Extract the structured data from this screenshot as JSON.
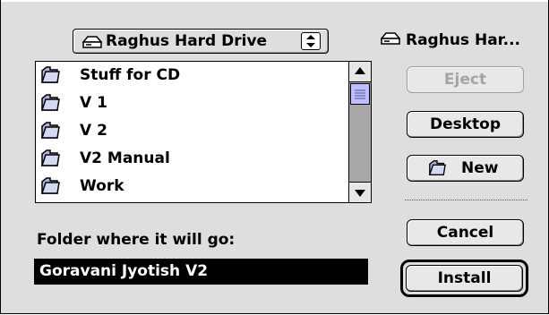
{
  "volume_popup": {
    "label": "Raghus Hard Drive",
    "icon": "hard-drive-icon",
    "arrows_icon": "updown-arrows-icon"
  },
  "volume_name": "Raghus Har...",
  "file_list": {
    "items": [
      {
        "name": "Stuff for CD",
        "icon": "folder-icon"
      },
      {
        "name": "V 1",
        "icon": "folder-icon"
      },
      {
        "name": "V 2",
        "icon": "folder-icon"
      },
      {
        "name": "V2 Manual",
        "icon": "folder-icon"
      },
      {
        "name": "Work",
        "icon": "folder-icon"
      }
    ]
  },
  "buttons": {
    "eject": "Eject",
    "desktop": "Desktop",
    "new": "New",
    "cancel": "Cancel",
    "install": "Install"
  },
  "folder_label": "Folder where it will go:",
  "folder_field_value": "Goravani Jyotish V2",
  "colors": {
    "dialog_bg": "#dedede",
    "scroll_thumb": "#bfbfff",
    "selection_bg": "#000000"
  }
}
